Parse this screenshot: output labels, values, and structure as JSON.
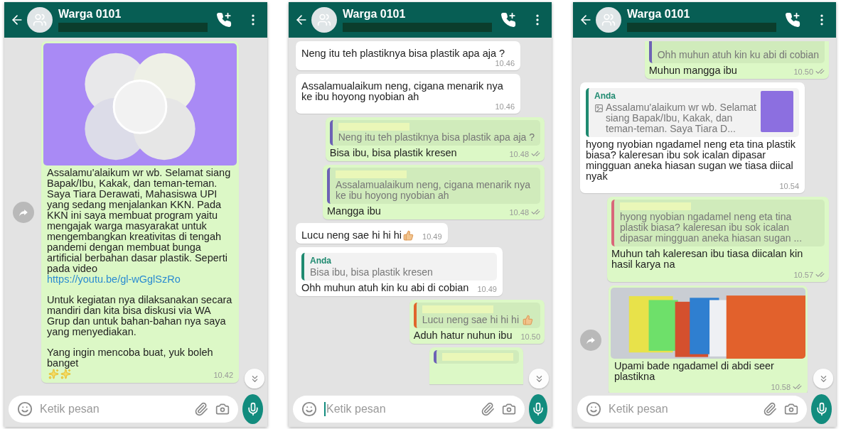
{
  "screens": [
    {
      "title": "Warga 0101",
      "placeholder": "Ketik pesan",
      "focused": false,
      "messages": [
        {
          "kind": "poster",
          "outgoing": true,
          "forward": true,
          "paragraphs": [
            {
              "kind": "text",
              "text": "Assalamu'alaikum wr wb. Selamat siang Bapak/Ibu, Kakak, dan teman-teman. Saya Tiara Derawati, Mahasiswa UPI yang sedang menjalankan KKN. Pada KKN ini saya membuat program yaitu mengajak warga masyarakat untuk mengembangkan kreativitas di tengah pandemi dengan membuat bunga artificial berbahan dasar plastik. Seperti pada video"
            },
            {
              "kind": "link",
              "text": "https://youtu.be/gl-wGglSzRo"
            },
            {
              "kind": "text",
              "text": "Untuk kegiatan nya dilaksanakan secara mandiri dan kita bisa diskusi via WA Grup dan untuk bahan-bahan nya saya yang menyediakan."
            },
            {
              "kind": "text",
              "text": "Yang ingin mencoba buat, yuk boleh banget"
            }
          ],
          "emoji": [
            {
              "kind": "sparkles"
            },
            {
              "kind": "sparkles"
            }
          ],
          "time": "10.42",
          "ticks": false
        }
      ]
    },
    {
      "title": "Warga 0101",
      "placeholder": "Ketik pesan",
      "focused": true,
      "messages": [
        {
          "kind": "text",
          "outgoing": false,
          "forward": false,
          "text": "Neng itu teh plastiknya bisa plastik apa aja ?",
          "time": "10.46",
          "ticks": false
        },
        {
          "kind": "text",
          "outgoing": false,
          "forward": false,
          "text": "Assalamualaikum neng, cigana menarik nya ke ibu hoyong nyobian ah",
          "time": "10.46",
          "ticks": false
        },
        {
          "kind": "text",
          "outgoing": true,
          "forward": false,
          "quote": {
            "text": "Neng itu teh plastiknya bisa plastik apa aja ?",
            "color": "#6d62b5"
          },
          "text": "Bisa ibu, bisa plastik kresen",
          "time": "10.48",
          "ticks": true
        },
        {
          "kind": "text",
          "outgoing": true,
          "forward": false,
          "quote": {
            "text": "Assalamualaikum neng, cigana menarik nya ke ibu hoyong nyobian ah",
            "color": "#6d62b5"
          },
          "text": "Mangga ibu",
          "time": "10.48",
          "ticks": true
        },
        {
          "kind": "text",
          "outgoing": false,
          "forward": false,
          "text": "Lucu neng sae hi hi hi",
          "emoji": [
            {
              "kind": "thumbs-up"
            }
          ],
          "time": "10.49",
          "ticks": false
        },
        {
          "kind": "text",
          "outgoing": false,
          "forward": false,
          "quote": {
            "author": "Anda",
            "text": "Bisa ibu, bisa plastik kresen",
            "color": "#1f8a70"
          },
          "text": "Ohh muhun atuh kin ku abi di cobian",
          "time": "10.49",
          "ticks": false
        },
        {
          "kind": "text",
          "outgoing": true,
          "forward": false,
          "quote": {
            "text": "Lucu neng sae hi hi hi",
            "emoji": [
              {
                "kind": "thumbs-up"
              }
            ],
            "color": "#e0662c"
          },
          "text": "Aduh hatur nuhun ibu",
          "time": "10.50",
          "ticks": false
        },
        {
          "kind": "cut_bottom",
          "outgoing": true,
          "forward": false,
          "quote": {
            "color": "#6d62b5"
          }
        }
      ]
    },
    {
      "title": "Warga 0101",
      "placeholder": "Ketik pesan",
      "focused": false,
      "messages": [
        {
          "kind": "cut_top",
          "outgoing": true,
          "forward": false,
          "quote": {
            "text": "Ohh muhun atuh kin ku abi di cobian",
            "color": "#6d62b5"
          },
          "text": "Muhun mangga ibu",
          "time": "10.50",
          "ticks": true
        },
        {
          "kind": "text",
          "outgoing": false,
          "forward": false,
          "quote": {
            "author": "Anda",
            "thumbnail": true,
            "text": "Assalamu'alaikum wr wb. Selamat siang Bapak/Ibu, Kakak, dan teman-teman. Saya Tiara D...",
            "color": "#1f8a70"
          },
          "text": "hyong nyobian ngadamel neng eta tina plastik biasa? kaleresan ibu sok icalan dipasar mingguan aneka hiasan sugan we tiasa diical nyak",
          "time": "10.54",
          "ticks": false
        },
        {
          "kind": "text",
          "outgoing": true,
          "forward": false,
          "quote": {
            "text": "hyong nyobian ngadamel neng eta tina plastik biasa? kaleresan ibu sok icalan dipasar mingguan aneka hiasan sugan ...",
            "color": "#d9677a"
          },
          "text": "Muhun tah kaleresan ibu tiasa diicalan kin hasil karya na",
          "time": "10.57",
          "ticks": true
        },
        {
          "kind": "photo",
          "outgoing": true,
          "forward": true,
          "text": "Upami bade ngadamel di abdi seer plastikna",
          "time": "10.58",
          "ticks": true
        }
      ]
    }
  ]
}
